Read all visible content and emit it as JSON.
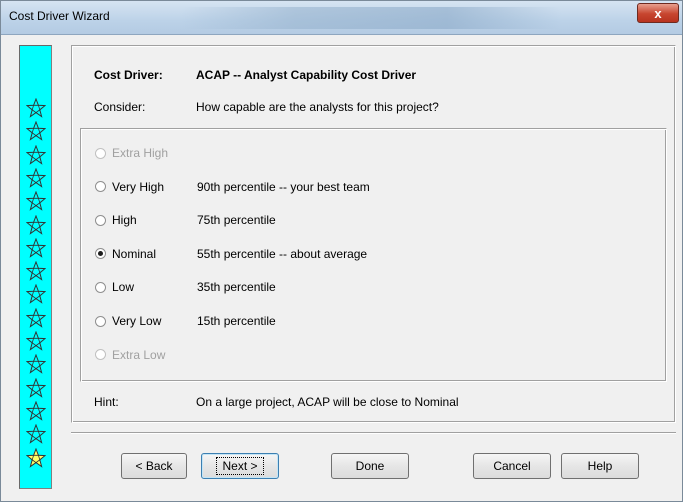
{
  "window": {
    "title": "Cost Driver Wizard",
    "close_label": "x"
  },
  "colors": {
    "star_strip": "#00ffff",
    "star_highlight": "#ffff66"
  },
  "header": {
    "driver_label": "Cost Driver:",
    "driver_value": "ACAP -- Analyst Capability Cost Driver",
    "consider_label": "Consider:",
    "consider_value": "How capable are the analysts for this project?"
  },
  "stars": {
    "icon": "star-outline-icon",
    "count": 16,
    "highlighted_index": 15
  },
  "options": [
    {
      "label": "Extra High",
      "description": "",
      "enabled": false,
      "selected": false
    },
    {
      "label": "Very High",
      "description": "90th percentile -- your best team",
      "enabled": true,
      "selected": false
    },
    {
      "label": "High",
      "description": "75th percentile",
      "enabled": true,
      "selected": false
    },
    {
      "label": "Nominal",
      "description": "55th percentile -- about average",
      "enabled": true,
      "selected": true
    },
    {
      "label": "Low",
      "description": "35th percentile",
      "enabled": true,
      "selected": false
    },
    {
      "label": "Very Low",
      "description": "15th percentile",
      "enabled": true,
      "selected": false
    },
    {
      "label": "Extra Low",
      "description": "",
      "enabled": false,
      "selected": false
    }
  ],
  "hint": {
    "label": "Hint:",
    "text": "On a large project, ACAP will be close to Nominal"
  },
  "buttons": {
    "back": "< Back",
    "next": "Next >",
    "done": "Done",
    "cancel": "Cancel",
    "help": "Help"
  }
}
